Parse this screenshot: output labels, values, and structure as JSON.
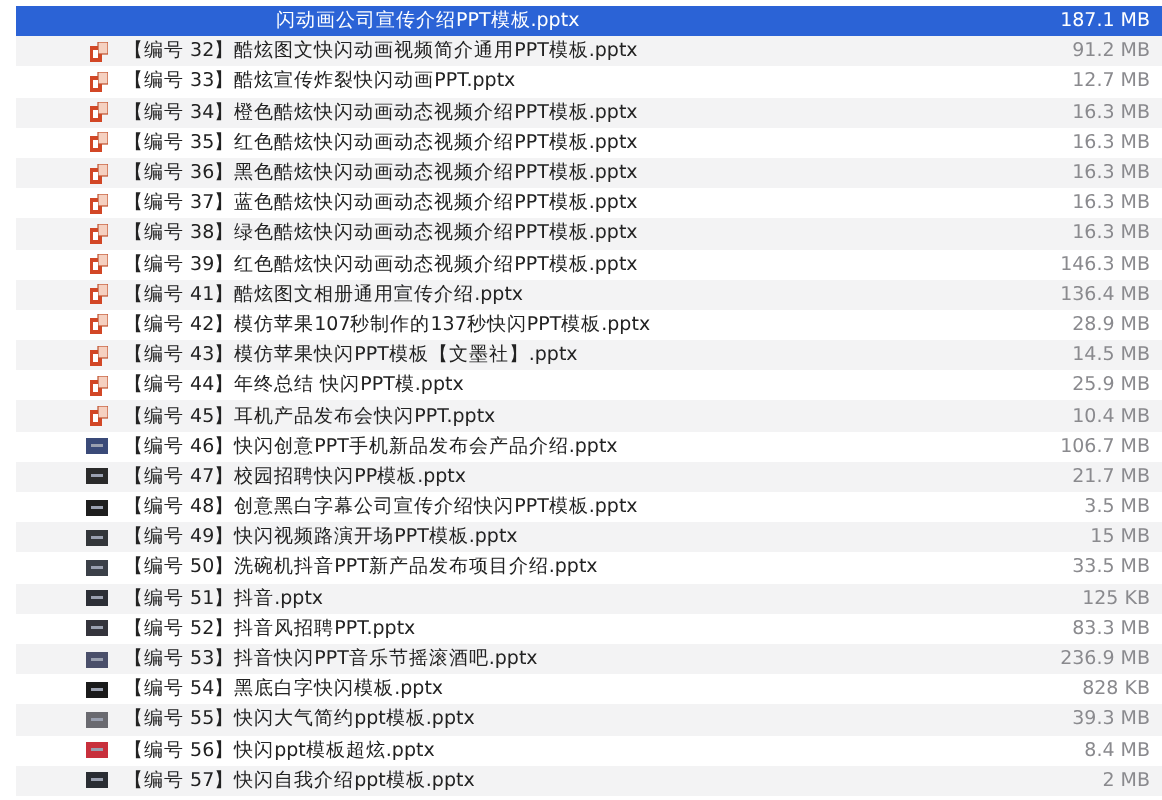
{
  "files": [
    {
      "name": "闪动画公司宣传介绍PPT模板.pptx",
      "size": "187.1 MB",
      "kind": "partial",
      "selected": true
    },
    {
      "name": "【编号 32】酷炫图文快闪动画视频简介通用PPT模板.pptx",
      "size": "91.2 MB",
      "kind": "presentation",
      "selected": false
    },
    {
      "name": "【编号 33】酷炫宣传炸裂快闪动画PPT.pptx",
      "size": "12.7 MB",
      "kind": "presentation",
      "selected": false
    },
    {
      "name": "【编号 34】橙色酷炫快闪动画动态视频介绍PPT模板.pptx",
      "size": "16.3 MB",
      "kind": "presentation",
      "selected": false
    },
    {
      "name": "【编号 35】红色酷炫快闪动画动态视频介绍PPT模板.pptx",
      "size": "16.3 MB",
      "kind": "presentation",
      "selected": false
    },
    {
      "name": "【编号 36】黑色酷炫快闪动画动态视频介绍PPT模板.pptx",
      "size": "16.3 MB",
      "kind": "presentation",
      "selected": false
    },
    {
      "name": "【编号 37】蓝色酷炫快闪动画动态视频介绍PPT模板.pptx",
      "size": "16.3 MB",
      "kind": "presentation",
      "selected": false
    },
    {
      "name": "【编号 38】绿色酷炫快闪动画动态视频介绍PPT模板.pptx",
      "size": "16.3 MB",
      "kind": "presentation",
      "selected": false
    },
    {
      "name": "【编号 39】红色酷炫快闪动画动态视频介绍PPT模板.pptx",
      "size": "146.3 MB",
      "kind": "presentation",
      "selected": false
    },
    {
      "name": "【编号 41】酷炫图文相册通用宣传介绍.pptx",
      "size": "136.4 MB",
      "kind": "presentation",
      "selected": false
    },
    {
      "name": "【编号 42】模仿苹果107秒制作的137秒快闪PPT模板.pptx",
      "size": "28.9 MB",
      "kind": "presentation",
      "selected": false
    },
    {
      "name": "【编号 43】模仿苹果快闪PPT模板【文墨社】.pptx",
      "size": "14.5 MB",
      "kind": "presentation",
      "selected": false
    },
    {
      "name": "【编号 44】年终总结 快闪PPT模.pptx",
      "size": "25.9 MB",
      "kind": "presentation",
      "selected": false
    },
    {
      "name": "【编号 45】耳机产品发布会快闪PPT.pptx",
      "size": "10.4 MB",
      "kind": "presentation",
      "selected": false
    },
    {
      "name": "【编号 46】快闪创意PPT手机新品发布会产品介绍.pptx",
      "size": "106.7 MB",
      "kind": "thumbnail",
      "color": "#3a4a78",
      "selected": false
    },
    {
      "name": "【编号 47】校园招聘快闪PP模板.pptx",
      "size": "21.7 MB",
      "kind": "thumbnail",
      "color": "#2a2a2a",
      "selected": false
    },
    {
      "name": "【编号 48】创意黑白字幕公司宣传介绍快闪PPT模板.pptx",
      "size": "3.5 MB",
      "kind": "thumbnail",
      "color": "#1e1e1e",
      "selected": false
    },
    {
      "name": "【编号 49】快闪视频路演开场PPT模板.pptx",
      "size": "15 MB",
      "kind": "thumbnail",
      "color": "#33363a",
      "selected": false
    },
    {
      "name": "【编号 50】洗碗机抖音PPT新产品发布项目介绍.pptx",
      "size": "33.5 MB",
      "kind": "thumbnail",
      "color": "#3b4048",
      "selected": false
    },
    {
      "name": "【编号 51】抖音.pptx",
      "size": "125 KB",
      "kind": "thumbnail",
      "color": "#2c2f36",
      "selected": false
    },
    {
      "name": "【编号 52】抖音风招聘PPT.pptx",
      "size": "83.3 MB",
      "kind": "thumbnail",
      "color": "#34343c",
      "selected": false
    },
    {
      "name": "【编号 53】抖音快闪PPT音乐节摇滚酒吧.pptx",
      "size": "236.9 MB",
      "kind": "thumbnail",
      "color": "#4a4f6a",
      "selected": false
    },
    {
      "name": "【编号 54】黑底白字快闪模板.pptx",
      "size": "828 KB",
      "kind": "thumbnail",
      "color": "#1a1a1a",
      "selected": false
    },
    {
      "name": "【编号 55】快闪大气简约ppt模板.pptx",
      "size": "39.3 MB",
      "kind": "thumbnail",
      "color": "#6a6a70",
      "selected": false
    },
    {
      "name": "【编号 56】快闪ppt模板超炫.pptx",
      "size": "8.4 MB",
      "kind": "thumbnail",
      "color": "#c8303c",
      "selected": false
    },
    {
      "name": "【编号 57】快闪自我介绍ppt模板.pptx",
      "size": "2 MB",
      "kind": "thumbnail",
      "color": "#2a2d33",
      "selected": false
    }
  ]
}
